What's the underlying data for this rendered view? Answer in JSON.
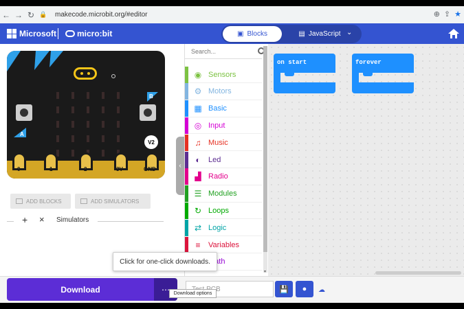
{
  "browser": {
    "url": "makecode.microbit.org/#editor"
  },
  "header": {
    "microsoft_label": "Microsoft",
    "microbit_label": "micro:bit",
    "tabs": [
      {
        "label": "Blocks",
        "selected": true
      },
      {
        "label": "JavaScript",
        "selected": false
      }
    ],
    "accent_color": "#3454d1"
  },
  "simulator": {
    "button_a": "A",
    "button_b": "B",
    "version_badge": "V2",
    "pins": [
      "0",
      "1",
      "2",
      "3V",
      "GND"
    ],
    "add_blocks_label": "ADD BLOCKS",
    "add_simulators_label": "ADD SIMULATORS",
    "simulators_label": "Simulators"
  },
  "toolbox": {
    "search_placeholder": "Search...",
    "categories": [
      {
        "label": "Sensors",
        "color": "#7cc242",
        "icon": "wifi-icon"
      },
      {
        "label": "Motors",
        "color": "#82b5e0",
        "icon": "gear-icon"
      },
      {
        "label": "Basic",
        "color": "#1e90ff",
        "icon": "grid-icon"
      },
      {
        "label": "Input",
        "color": "#d400d4",
        "icon": "target-icon"
      },
      {
        "label": "Music",
        "color": "#e63022",
        "icon": "headphones-icon"
      },
      {
        "label": "Led",
        "color": "#5c2d91",
        "icon": "toggle-icon"
      },
      {
        "label": "Radio",
        "color": "#e3008c",
        "icon": "signal-icon"
      },
      {
        "label": "Modules",
        "color": "#20a020",
        "icon": "list-icon"
      },
      {
        "label": "Loops",
        "color": "#00aa00",
        "icon": "refresh-icon"
      },
      {
        "label": "Logic",
        "color": "#00a4a6",
        "icon": "shuffle-icon"
      },
      {
        "label": "Variables",
        "color": "#dc143c",
        "icon": "lines-icon"
      },
      {
        "label": "Math",
        "color": "#9400d3",
        "icon": "calculator-icon"
      }
    ]
  },
  "workspace": {
    "blocks": [
      {
        "label": "on start"
      },
      {
        "label": "forever"
      }
    ],
    "block_color": "#1e90ff"
  },
  "bottombar": {
    "download_label": "Download",
    "project_name_placeholder": "Test PCB",
    "tooltip": "Click for one-click downloads.",
    "download_options_tooltip": "Download options"
  }
}
